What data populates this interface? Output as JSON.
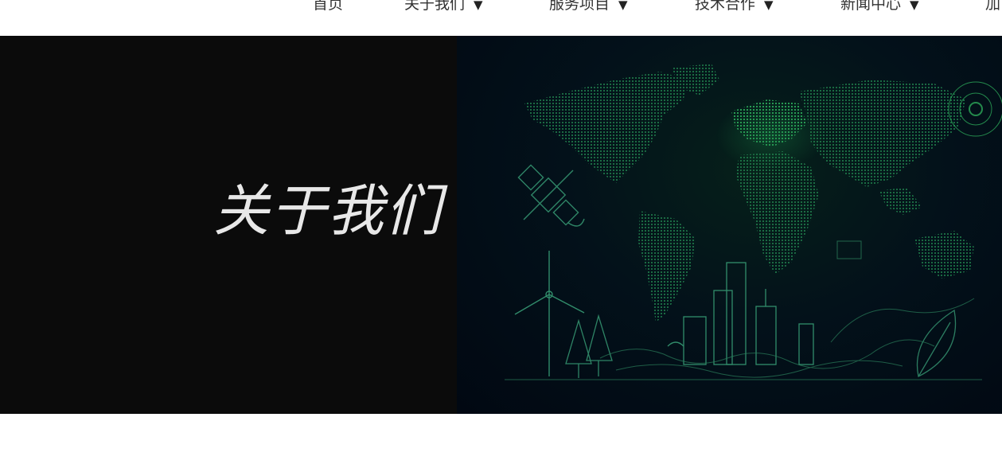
{
  "nav": {
    "items": [
      {
        "label": "首页",
        "has_dropdown": false
      },
      {
        "label": "关于我们",
        "has_dropdown": true
      },
      {
        "label": "服务项目",
        "has_dropdown": true
      },
      {
        "label": "技术合作",
        "has_dropdown": true
      },
      {
        "label": "新闻中心",
        "has_dropdown": true
      },
      {
        "label": "加",
        "has_dropdown": false
      }
    ],
    "caret": "▼"
  },
  "hero": {
    "title": "关于我们",
    "colors": {
      "left_background": "#0b0b0b",
      "art_background": "#010812",
      "accent_green": "#1f9c52"
    }
  }
}
